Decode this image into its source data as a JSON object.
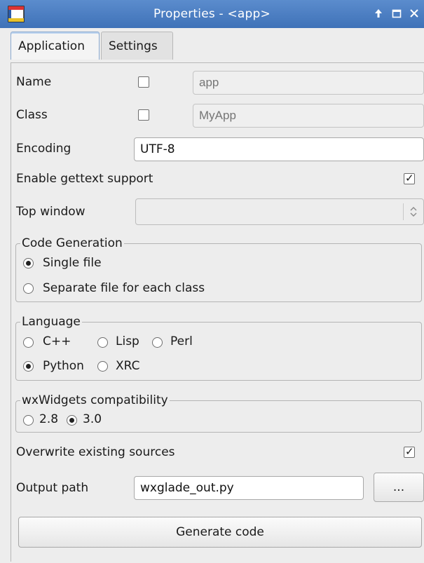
{
  "window": {
    "title": "Properties - <app>"
  },
  "tabs": [
    {
      "label": "Application",
      "active": true
    },
    {
      "label": "Settings",
      "active": false
    }
  ],
  "fields": {
    "name": {
      "label": "Name",
      "checked": false,
      "placeholder": "app"
    },
    "class": {
      "label": "Class",
      "checked": false,
      "placeholder": "MyApp"
    },
    "encoding": {
      "label": "Encoding",
      "value": "UTF-8"
    },
    "gettext": {
      "label": "Enable gettext support",
      "checked": true
    },
    "top_window": {
      "label": "Top window",
      "value": ""
    }
  },
  "code_generation": {
    "title": "Code Generation",
    "options": [
      {
        "label": "Single file",
        "selected": true
      },
      {
        "label": "Separate file for each class",
        "selected": false
      }
    ]
  },
  "language": {
    "title": "Language",
    "options": [
      {
        "label": "C++",
        "selected": false
      },
      {
        "label": "Lisp",
        "selected": false
      },
      {
        "label": "Perl",
        "selected": false
      },
      {
        "label": "Python",
        "selected": true
      },
      {
        "label": "XRC",
        "selected": false
      }
    ]
  },
  "compat": {
    "title": "wxWidgets compatibility",
    "options": [
      {
        "label": "2.8",
        "selected": false
      },
      {
        "label": "3.0",
        "selected": true
      }
    ]
  },
  "overwrite": {
    "label": "Overwrite existing sources",
    "checked": true
  },
  "output": {
    "label": "Output path",
    "value": "wxglade_out.py",
    "browse_label": "..."
  },
  "generate_label": "Generate code",
  "colors": {
    "titlebar": "#4a7dc2",
    "background": "#ededed"
  }
}
